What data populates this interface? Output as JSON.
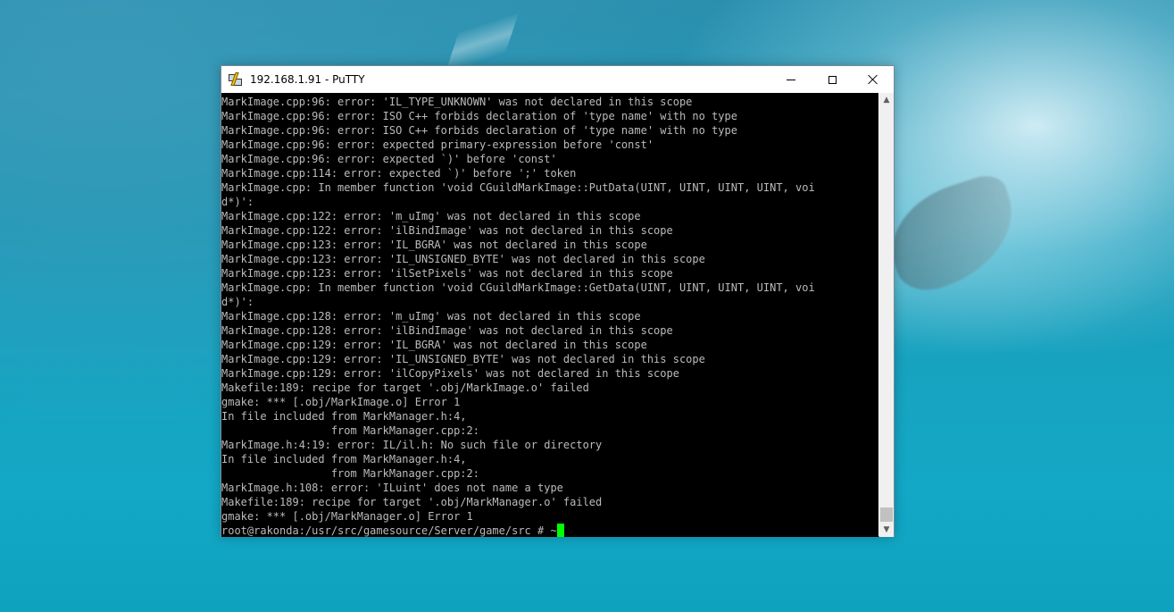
{
  "window": {
    "title": "192.168.1.91 - PuTTY",
    "icon": "putty-icon",
    "controls": {
      "minimize": "minimize-icon",
      "maximize": "maximize-icon",
      "close": "close-icon"
    }
  },
  "terminal": {
    "lines": [
      "MarkImage.cpp:96: error: 'IL_TYPE_UNKNOWN' was not declared in this scope",
      "MarkImage.cpp:96: error: ISO C++ forbids declaration of 'type name' with no type",
      "MarkImage.cpp:96: error: ISO C++ forbids declaration of 'type name' with no type",
      "MarkImage.cpp:96: error: expected primary-expression before 'const'",
      "MarkImage.cpp:96: error: expected `)' before 'const'",
      "MarkImage.cpp:114: error: expected `)' before ';' token",
      "MarkImage.cpp: In member function 'void CGuildMarkImage::PutData(UINT, UINT, UINT, UINT, voi",
      "d*)':",
      "MarkImage.cpp:122: error: 'm_uImg' was not declared in this scope",
      "MarkImage.cpp:122: error: 'ilBindImage' was not declared in this scope",
      "MarkImage.cpp:123: error: 'IL_BGRA' was not declared in this scope",
      "MarkImage.cpp:123: error: 'IL_UNSIGNED_BYTE' was not declared in this scope",
      "MarkImage.cpp:123: error: 'ilSetPixels' was not declared in this scope",
      "MarkImage.cpp: In member function 'void CGuildMarkImage::GetData(UINT, UINT, UINT, UINT, voi",
      "d*)':",
      "MarkImage.cpp:128: error: 'm_uImg' was not declared in this scope",
      "MarkImage.cpp:128: error: 'ilBindImage' was not declared in this scope",
      "MarkImage.cpp:129: error: 'IL_BGRA' was not declared in this scope",
      "MarkImage.cpp:129: error: 'IL_UNSIGNED_BYTE' was not declared in this scope",
      "MarkImage.cpp:129: error: 'ilCopyPixels' was not declared in this scope",
      "Makefile:189: recipe for target '.obj/MarkImage.o' failed",
      "gmake: *** [.obj/MarkImage.o] Error 1",
      "In file included from MarkManager.h:4,",
      "                 from MarkManager.cpp:2:",
      "MarkImage.h:4:19: error: IL/il.h: No such file or directory",
      "In file included from MarkManager.h:4,",
      "                 from MarkManager.cpp:2:",
      "MarkImage.h:108: error: 'ILuint' does not name a type",
      "Makefile:189: recipe for target '.obj/MarkManager.o' failed",
      "gmake: *** [.obj/MarkManager.o] Error 1"
    ],
    "prompt": "root@rakonda:/usr/src/gamesource/Server/game/src # ~",
    "cursor_color": "#00ff00",
    "text_color": "#bbbbbb",
    "background": "#000000"
  },
  "scrollbar": {
    "up_icon": "scroll-up-arrow-icon",
    "down_icon": "scroll-down-arrow-icon"
  }
}
